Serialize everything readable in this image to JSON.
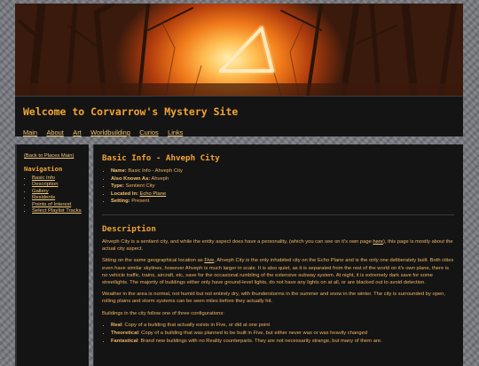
{
  "site_title": "Welcome to Corvarrow's Mystery Site",
  "top_nav": [
    "Main",
    "About",
    "Art",
    "Worldbuilding",
    "Curios",
    "Links"
  ],
  "sidebar": {
    "back_link": "(Back to Places Main)",
    "heading": "Navigation",
    "items": [
      "Basic Info",
      "Description",
      "Gallery",
      "Residents",
      "Points of Interest",
      "Select Playlist Tracks"
    ]
  },
  "basic_info": {
    "heading": "Basic Info - Ahveph City",
    "rows": [
      {
        "label": "Name:",
        "value": "Basic Info - Ahveph City"
      },
      {
        "label": "Also Known As:",
        "value": "Ahveph"
      },
      {
        "label": "Type:",
        "value": "Sentient City"
      },
      {
        "label": "Located In:",
        "value": "Echo Plane"
      },
      {
        "label": "Setting:",
        "value": "Present"
      }
    ]
  },
  "description": {
    "heading": "Description",
    "p1_before": "Ahveph City is a sentient city, and while the entity aspect does have a personality, (which you can see on it's own page ",
    "p1_link": "here",
    "p1_after": "), this page is mostly about the actual city aspect.",
    "p2_before": "Sitting on the same geographical location as ",
    "p2_link": "Five",
    "p2_after": ", Ahveph City is the only inhabited city on the Echo Plane and is the only one deliberately built. Both cities even have similar skylines, however Ahveph is much larger in scale. It is also quiet, as it is separated from the rest of the world on it's own plane, there is no vehicle traffic, trains, aircraft, etc, save for the occasional rumbling of the extensive subway system. At night, it is extremely dark save for some streetlights. The majority of buildings either only have ground-level lights, do not have any lights on at all, or are blacked out to avoid detection.",
    "p3": "Weather in the area is normal, not humid but not entirely dry, with thunderstorms in the summer and snow in the winter. The city is surrounded by open, rolling plains and storm systems can be seen miles before they actually hit.",
    "p4": "Buildings in the city follow one of three configurations:",
    "configs": [
      {
        "label": "Real",
        "text": ": Copy of a building that actually exists in Five, or did at one point"
      },
      {
        "label": "Theoretical",
        "text": ": Copy of a building that was planned to be built in Five, but either never was or was heavily changed"
      },
      {
        "label": "Fantastical",
        "text": ": Brand new buildings with no Reality counterparts. They are not necessarily strange, but many of them are."
      }
    ]
  },
  "colors": {
    "accent": "#f3a533",
    "link": "#f4c87a",
    "panel": "#141414",
    "background": "#7c7e85"
  }
}
